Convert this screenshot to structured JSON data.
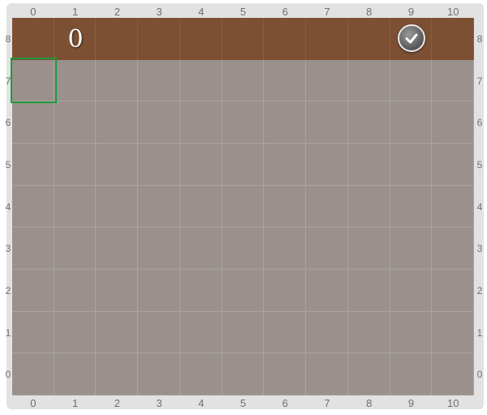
{
  "board": {
    "columns": [
      "0",
      "1",
      "2",
      "3",
      "4",
      "5",
      "6",
      "7",
      "8",
      "9",
      "10"
    ],
    "rows_top_to_bottom": [
      "8",
      "7",
      "6",
      "5",
      "4",
      "3",
      "2",
      "1",
      "0"
    ]
  },
  "score": "0",
  "check_button": {
    "icon": "checkmark-icon"
  },
  "selection": {
    "column": "0",
    "row": "7"
  },
  "colors": {
    "header_row": "#7d5034",
    "board_cell": "#9a918c",
    "selection_border": "#1f9a3c"
  }
}
